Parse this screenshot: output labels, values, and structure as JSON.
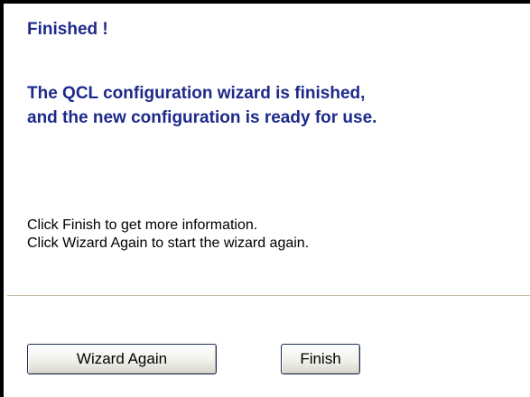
{
  "wizard": {
    "title": "Finished !",
    "message_lines": [
      "The QCL configuration wizard is finished,",
      "and the new configuration is ready for use."
    ],
    "info_lines": [
      "Click Finish to get more information.",
      "Click Wizard Again to start the wizard again."
    ],
    "buttons": {
      "wizard_again_label": "Wizard Again",
      "finish_label": "Finish"
    }
  },
  "colors": {
    "heading_text": "#1c2a8a",
    "body_text": "#000000",
    "divider": "#c8bea6",
    "button_border": "#1a2d5c",
    "frame_border": "#000000"
  }
}
